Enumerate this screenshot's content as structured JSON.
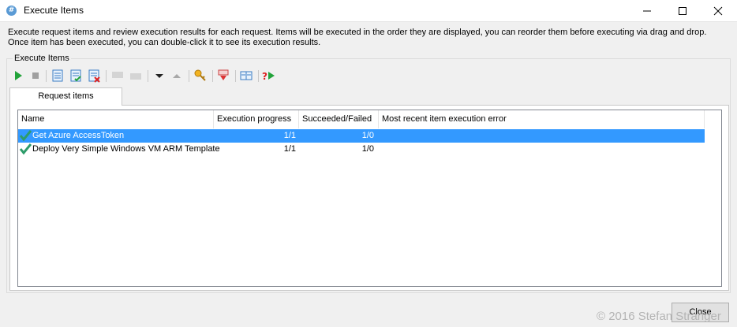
{
  "window": {
    "title": "Execute Items",
    "app_icon_glyph": "#"
  },
  "description": "Execute request items and review execution results for each request. Items will be executed in the order they are displayed, you can reorder them before executing via drag and drop. Once item has been executed, you can double-click it to see its execution results.",
  "group": {
    "title": "Execute Items"
  },
  "toolbar": {
    "buttons": [
      {
        "name": "run-icon",
        "enabled": true
      },
      {
        "name": "stop-icon",
        "enabled": false
      },
      {
        "name": "list-icon",
        "enabled": true
      },
      {
        "name": "list-check-icon",
        "enabled": true
      },
      {
        "name": "list-remove-icon",
        "enabled": true
      },
      {
        "name": "disabled-icon-1",
        "enabled": false
      },
      {
        "name": "disabled-icon-2",
        "enabled": false
      },
      {
        "name": "move-down-icon",
        "enabled": true
      },
      {
        "name": "move-up-icon",
        "enabled": false
      },
      {
        "name": "key-icon",
        "enabled": true
      },
      {
        "name": "download-icon",
        "enabled": true
      },
      {
        "name": "columns-icon",
        "enabled": true
      },
      {
        "name": "help-run-icon",
        "enabled": true
      }
    ]
  },
  "tabs": [
    {
      "label": "Request items",
      "active": true
    }
  ],
  "list": {
    "columns": [
      "Name",
      "Execution progress",
      "Succeeded/Failed",
      "Most recent item execution error"
    ],
    "rows": [
      {
        "name": "Get Azure AccessToken",
        "progress": "1/1",
        "succeeded_failed": "1/0",
        "error": "",
        "selected": true,
        "status_icon": "check-icon"
      },
      {
        "name": "Deploy Very Simple Windows VM ARM Template",
        "progress": "1/1",
        "succeeded_failed": "1/0",
        "error": "",
        "selected": false,
        "status_icon": "check-icon"
      }
    ]
  },
  "close_label": "Close",
  "watermark": "© 2016 Stefan Stranger",
  "colors": {
    "selection": "#3399ff",
    "check": "#2e9c6a"
  }
}
